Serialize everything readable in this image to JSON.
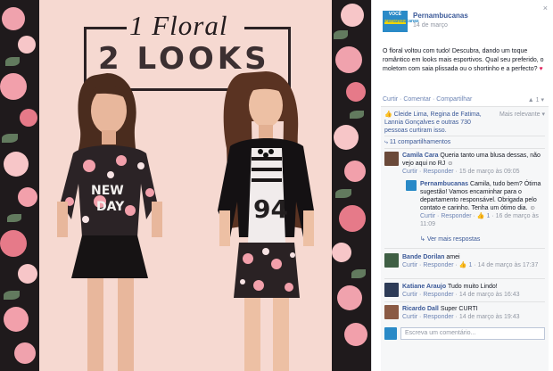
{
  "photo": {
    "title_line1": "1 Floral",
    "title_line2": "2 LOOKS",
    "model1_shirt": "NEW\nDAY",
    "model2_shirt": "94"
  },
  "post": {
    "page_name": "Pernambucanas",
    "logo_text": "VOCÊ",
    "logo_sub": "Pernambucanas",
    "date": "14 de março",
    "close": "×",
    "text": "O floral voltou com tudo! Descubra, dando um toque romântico em looks mais esportivos. Qual seu preferido, o moletom com saia plissada ou o shortinho e a perfecto?",
    "actions": "Curtir · Comentar · Compartilhar",
    "action_icons": "▲ 1 ▾"
  },
  "ufi": {
    "likes_text": "Cleide Lima, Regina de Fatima, Lannia Gonçalves e outras 730 pessoas curtiram isso.",
    "sort_label": "Mais relevante ▾",
    "shares": "11 compartilhamentos",
    "comments": [
      {
        "author": "Camila Cara",
        "text": "Queria tanto uma blusa dessas, não vejo aqui no RJ",
        "actions": "Curtir · Responder",
        "time": "15 de março às 09:05"
      },
      {
        "author": "Pernambucanas",
        "text": "Camila, tudo bem? Ótima sugestão! Vamos encaminhar para o departamento responsável. Obrigada pelo contato e carinho. Tenha um ótimo dia.",
        "actions": "Curtir · Responder",
        "likes": "1",
        "time": "16 de março às 11:09"
      }
    ],
    "more_replies": "Ver mais respostas",
    "comments2": [
      {
        "author": "Bande Dorilan",
        "text": "amei",
        "actions": "Curtir · Responder",
        "likes": "1",
        "time": "14 de março às 17:37"
      },
      {
        "author": "Katiane Araujo",
        "text": "Tudo muito Lindo!",
        "actions": "Curtir · Responder",
        "time": "14 de março às 16:43"
      },
      {
        "author": "Ricardo Dall",
        "text": "Super CURTI",
        "actions": "Curtir · Responder",
        "time": "14 de março às 19:43"
      }
    ],
    "comment_placeholder": "Escreva um comentário..."
  },
  "colors": {
    "brand": "#3b5998",
    "photo_background": "#f6d9d1"
  }
}
